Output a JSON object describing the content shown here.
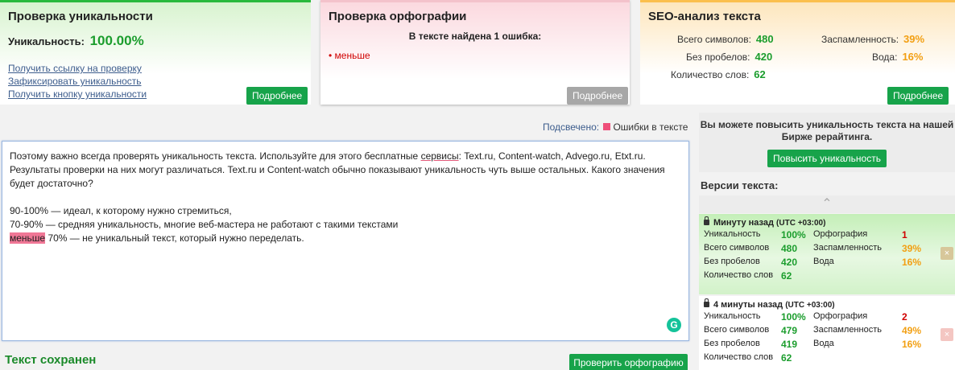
{
  "uniqueness": {
    "title": "Проверка уникальности",
    "label": "Уникальность:",
    "value": "100.00%",
    "links": [
      "Получить ссылку на проверку",
      "Зафиксировать уникальность",
      "Получить кнопку уникальности"
    ],
    "more": "Подробнее"
  },
  "spelling": {
    "title": "Проверка орфографии",
    "found": "В тексте найдена 1 ошибка:",
    "errors": [
      "меньше"
    ],
    "more": "Подробнее"
  },
  "seo": {
    "title": "SEO-анализ текста",
    "total_chars_label": "Всего символов:",
    "total_chars": "480",
    "no_spaces_label": "Без пробелов:",
    "no_spaces": "420",
    "words_label": "Количество слов:",
    "words": "62",
    "spam_label": "Заспамленность:",
    "spam": "39%",
    "water_label": "Вода:",
    "water": "16%",
    "more": "Подробнее"
  },
  "legend": {
    "prefix": "Подсвечено:",
    "errors": "Ошибки в тексте"
  },
  "editor": {
    "line1_a": "Поэтому важно всегда проверять уникальность текста. Используйте для этого бесплатные ",
    "line1_u": "сервисы",
    "line1_b": ": Text.ru, Content-watch, Advego.ru, Etxt.ru.",
    "line2": "Результаты проверки на них могут различаться. Text.ru и Content-watch обычно показывают уникальность чуть выше остальных. Какого значения",
    "line3": "будет достаточно?",
    "line4": "90-100% — идеал, к которому нужно стремиться,",
    "line5": "70-90% — средняя уникальность, многие веб-мастера не работают с такими текстами",
    "line6_err": "меньше",
    "line6_rest": " 70% — не уникальный текст, который нужно переделать.",
    "grammarly": "G"
  },
  "status": {
    "saved": "Текст сохранен",
    "check_spelling": "Проверить орфографию"
  },
  "promo": {
    "text": "Вы можете повысить уникальность текста на нашей Бирже рерайтинга.",
    "button": "Повысить уникальность"
  },
  "versions": {
    "title": "Версии текста:",
    "labels": {
      "uniq": "Уникальность",
      "total": "Всего символов",
      "nospace": "Без пробелов",
      "words": "Количество слов",
      "spell": "Орфография",
      "spam": "Заспамленность",
      "water": "Вода"
    },
    "items": [
      {
        "time": "Минуту назад",
        "tz": "(UTC +03:00)",
        "uniq": "100%",
        "total": "480",
        "nospace": "420",
        "words": "62",
        "spell": "1",
        "spam": "39%",
        "water": "16%"
      },
      {
        "time": "4 минуты назад",
        "tz": "(UTC +03:00)",
        "uniq": "100%",
        "total": "479",
        "nospace": "419",
        "words": "62",
        "spell": "2",
        "spam": "49%",
        "water": "16%"
      }
    ],
    "close": "×"
  }
}
